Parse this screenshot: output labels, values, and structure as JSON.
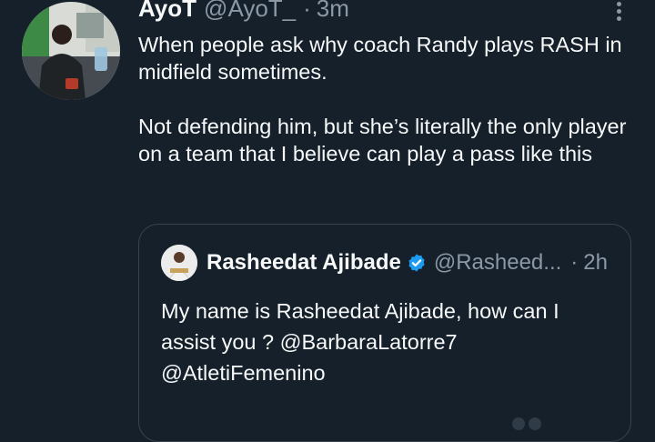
{
  "tweet": {
    "author_name": "AyoT",
    "author_handle": "@AyoT_",
    "separator": "·",
    "time": "3m",
    "paragraphs": [
      "When people ask why coach Randy plays RASH in midfield sometimes.",
      "Not defending him, but she’s literally the only player on a team that I believe can play a pass like this"
    ]
  },
  "quoted": {
    "author_name": "Rasheedat Ajibade",
    "author_handle": "@Rasheed...",
    "separator": "·",
    "time": "2h",
    "lines": [
      "My name is Rasheedat Ajibade, how can I",
      "assist you ? @BarbaraLatorre7",
      "@AtletiFemenino"
    ]
  },
  "icons": {
    "more": "more-vertical-icon",
    "verified": "verified-badge-icon"
  },
  "colors": {
    "background": "#15202b",
    "text": "#f7f9f9",
    "secondary": "#8b98a5",
    "border": "#38444d",
    "verified": "#1d9bf0"
  }
}
